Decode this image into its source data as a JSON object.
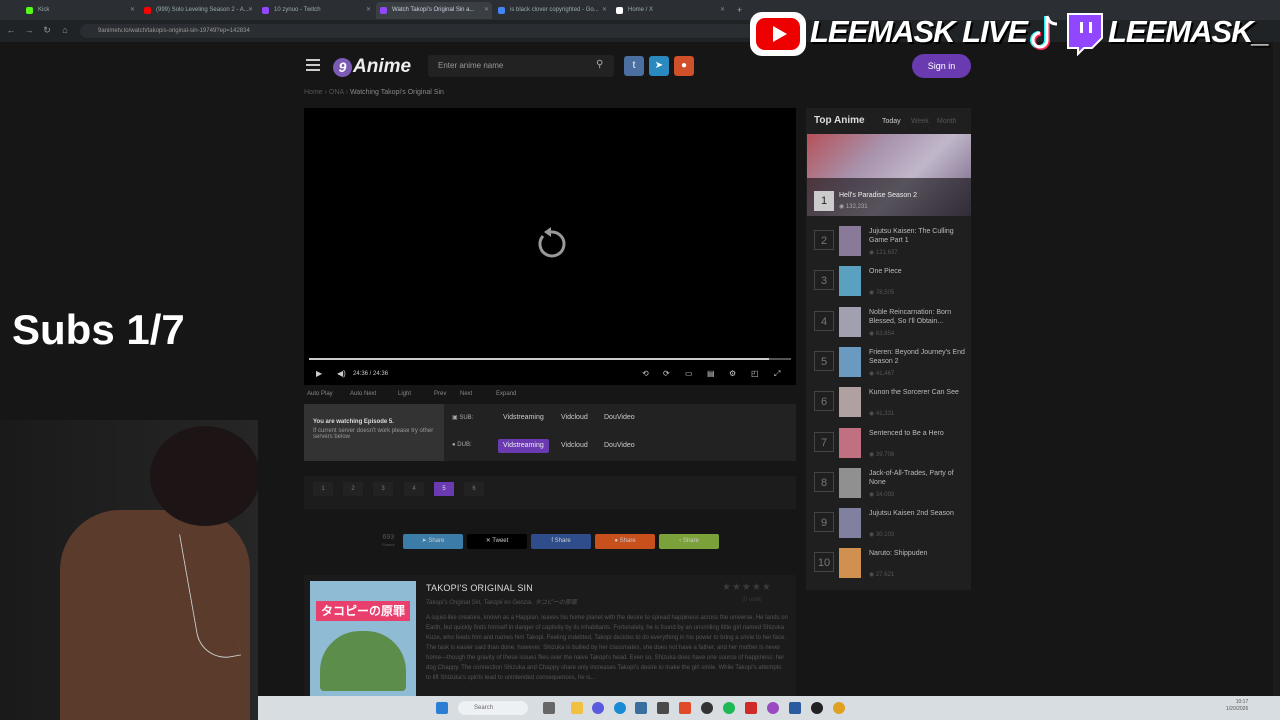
{
  "browser": {
    "tabs": [
      {
        "label": "Kick",
        "color": "#53fc18"
      },
      {
        "label": "(999) Solo Leveling Season 2 - A...",
        "color": "#ff0000"
      },
      {
        "label": "10 zynuo - Twitch",
        "color": "#9146ff"
      },
      {
        "label": "Watch Takopi's Original Sin a...",
        "color": "#9146ff"
      },
      {
        "label": "is black clover copyrighted - Go...",
        "color": "#4285f4"
      },
      {
        "label": "Home / X",
        "color": "#ffffff"
      }
    ],
    "url": "9animetv.to/watch/takopis-original-sin-19749?ep=142834"
  },
  "site": {
    "logo": "Anime",
    "logo_mark": "9",
    "search_placeholder": "Enter anime name",
    "signin": "Sign in",
    "breadcrumb": [
      "Home",
      "ONA",
      "Watching Takopi's Original Sin"
    ]
  },
  "player": {
    "time": "24:36 / 24:36",
    "controls": [
      "Auto Play",
      "Auto Next",
      "Light",
      "Prev",
      "Next",
      "Expand"
    ]
  },
  "servers": {
    "info_title": "You are watching Episode 5.",
    "info_text": "If current server doesn't work please try other servers below",
    "sub_label": "SUB:",
    "dub_label": "DUB:",
    "sub": [
      "Vidstreaming",
      "Vidcloud",
      "DouVideo"
    ],
    "dub": [
      "Vidstreaming",
      "Vidcloud",
      "DouVideo"
    ]
  },
  "episodes": [
    "1",
    "2",
    "3",
    "4",
    "5",
    "6"
  ],
  "share": {
    "count": "693",
    "count_label": "Shares",
    "buttons": [
      {
        "label": "Share",
        "color": "#3b7ca8"
      },
      {
        "label": "Tweet",
        "color": "#000000"
      },
      {
        "label": "Share",
        "color": "#2e4d8a"
      },
      {
        "label": "Share",
        "color": "#c8501c"
      },
      {
        "label": "Share",
        "color": "#7ba23a"
      }
    ]
  },
  "anime": {
    "title": "TAKOPI'S ORIGINAL SIN",
    "alt": "Takopi's Original Sin, Takopii no Genzai, タコピーの原罪",
    "votes": "(0 vote)",
    "poster_text": "タコピーの原罪",
    "description": "A squid-like creature, known as a Happian, leaves his home planet with the desire to spread happiness across the universe. He lands on Earth, but quickly finds himself in danger of captivity by its inhabitants. Fortunately, he is found by an unsmiling little girl named Shizuka Kuze, who feeds him and names him Takopi. Feeling indebted, Takopi decides to do everything in his power to bring a smile to her face. The task is easier said than done, however. Shizuka is bullied by her classmates, she does not have a father, and her mother is never home—though the gravity of these issues flies over the naive Takopi's head. Even so, Shizuka does have one source of happiness: her dog Chappy. The connection Shizuka and Chappy share only increases Takopi's desire to make the girl smile. While Takopi's attempts to lift Shizuka's spirits lead to unintended consequences, he is..."
  },
  "top_anime": {
    "title": "Top Anime",
    "tabs": [
      "Today",
      "Week",
      "Month"
    ],
    "items": [
      {
        "rank": "1",
        "name": "Hell's Paradise Season 2",
        "views": "132,231",
        "color": "#c06060"
      },
      {
        "rank": "2",
        "name": "Jujutsu Kaisen: The Culling Game Part 1",
        "views": "121,637",
        "color": "#8a7a9a"
      },
      {
        "rank": "3",
        "name": "One Piece",
        "views": "78,505",
        "color": "#5aa0c0"
      },
      {
        "rank": "4",
        "name": "Noble Reincarnation: Born Blessed, So I'll Obtain...",
        "views": "63,854",
        "color": "#a0a0b0"
      },
      {
        "rank": "5",
        "name": "Frieren: Beyond Journey's End Season 2",
        "views": "41,467",
        "color": "#6a9ac0"
      },
      {
        "rank": "6",
        "name": "Kunon the Sorcerer Can See",
        "views": "41,331",
        "color": "#b0a0a0"
      },
      {
        "rank": "7",
        "name": "Sentenced to Be a Hero",
        "views": "39,706",
        "color": "#c07080"
      },
      {
        "rank": "8",
        "name": "Jack-of-All-Trades, Party of None",
        "views": "34,093",
        "color": "#909090"
      },
      {
        "rank": "9",
        "name": "Jujutsu Kaisen 2nd Season",
        "views": "30,103",
        "color": "#8080a0"
      },
      {
        "rank": "10",
        "name": "Naruto: Shippuden",
        "views": "27,621",
        "color": "#d09050"
      }
    ]
  },
  "overlay": {
    "yt_name": "LEEMASK LIVE",
    "twitch_name": "LEEMASK_",
    "subs": "Subs 1/7"
  },
  "taskbar": {
    "search": "Search",
    "clock_time": "10:17",
    "clock_date": "1/20/2026"
  }
}
